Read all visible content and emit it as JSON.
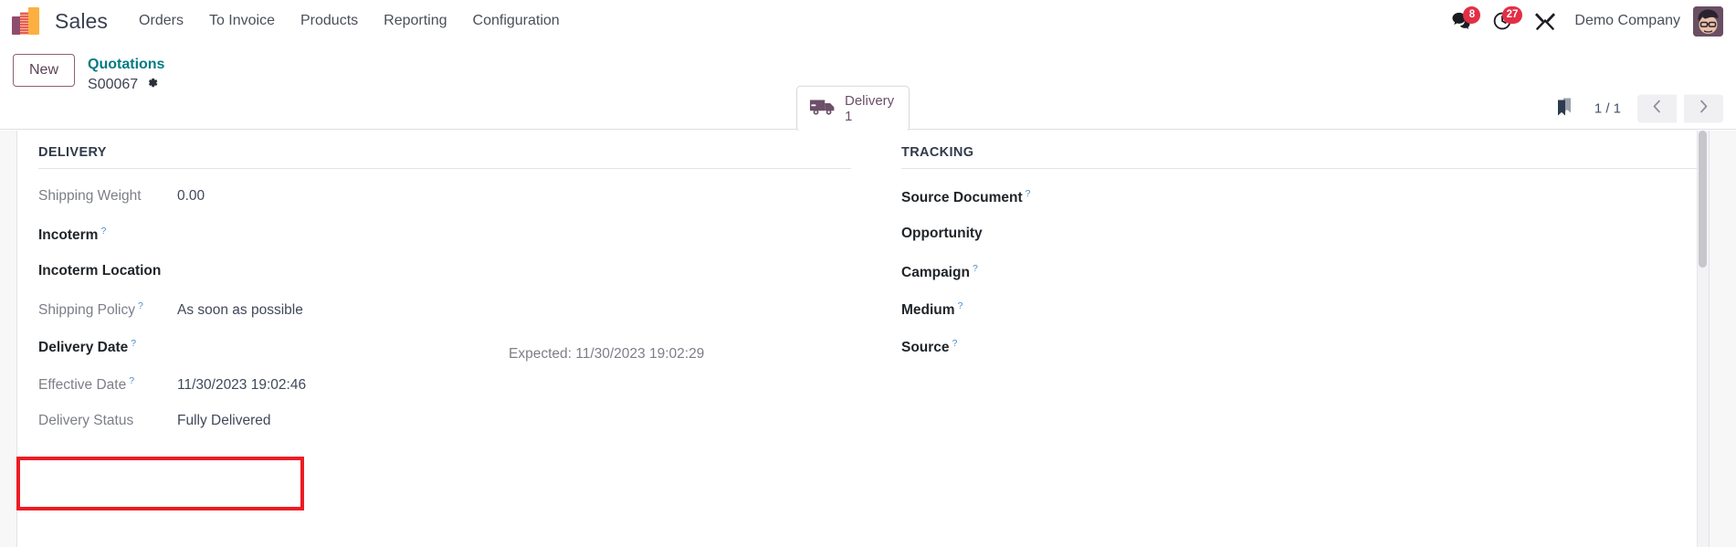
{
  "navbar": {
    "logo_icon": "odoo-bars-logo",
    "app_name": "Sales",
    "menus": [
      {
        "label": "Orders"
      },
      {
        "label": "To Invoice"
      },
      {
        "label": "Products"
      },
      {
        "label": "Reporting"
      },
      {
        "label": "Configuration"
      }
    ],
    "messages": {
      "icon": "messages-icon",
      "count": "8"
    },
    "activities": {
      "icon": "clock-activity-icon",
      "count": "27"
    },
    "debug": {
      "icon": "wrench-tools-icon"
    },
    "company": "Demo Company",
    "avatar_icon": "user-avatar"
  },
  "control_panel": {
    "new_button": "New",
    "breadcrumb_parent": "Quotations",
    "breadcrumb_current": "S00067",
    "settings_icon": "gear-icon",
    "stat_button": {
      "icon": "delivery-truck-icon",
      "label": "Delivery",
      "value": "1"
    },
    "bookmark_icon": "bookmark-icon",
    "pager": "1 / 1",
    "prev_icon": "chevron-left-icon",
    "next_icon": "chevron-right-icon"
  },
  "form": {
    "delivery": {
      "title": "DELIVERY",
      "fields": [
        {
          "label": "Shipping Weight",
          "tooltip": "",
          "value": "0.00",
          "style": "readonly"
        },
        {
          "label": "Incoterm",
          "tooltip": "?",
          "value": "",
          "style": "editable"
        },
        {
          "label": "Incoterm Location",
          "tooltip": "",
          "value": "",
          "style": "editable"
        },
        {
          "label": "Shipping Policy",
          "tooltip": "?",
          "value": "As soon as possible",
          "style": "readonly"
        },
        {
          "label": "Delivery Date",
          "tooltip": "?",
          "value": "",
          "style": "editable",
          "note": "Expected: 11/30/2023 19:02:29"
        },
        {
          "label": "Effective Date",
          "tooltip": "?",
          "value": "11/30/2023 19:02:46",
          "style": "readonly"
        },
        {
          "label": "Delivery Status",
          "tooltip": "",
          "value": "Fully Delivered",
          "style": "readonly"
        }
      ]
    },
    "tracking": {
      "title": "TRACKING",
      "fields": [
        {
          "label": "Source Document",
          "tooltip": "?",
          "value": "",
          "style": "editable"
        },
        {
          "label": "Opportunity",
          "tooltip": "",
          "value": "",
          "style": "editable"
        },
        {
          "label": "Campaign",
          "tooltip": "?",
          "value": "",
          "style": "editable"
        },
        {
          "label": "Medium",
          "tooltip": "?",
          "value": "",
          "style": "editable"
        },
        {
          "label": "Source",
          "tooltip": "?",
          "value": "",
          "style": "editable"
        }
      ]
    }
  },
  "annotation": {
    "highlight_color": "#ec1c24",
    "highlight_target": "Delivery Status"
  }
}
